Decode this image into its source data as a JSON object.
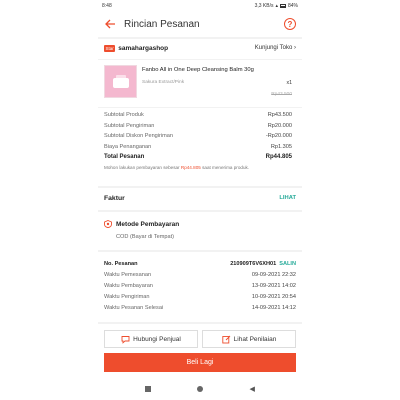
{
  "statusbar": {
    "time": "8:48",
    "speed": "3,3 KB/s",
    "battery": "84%"
  },
  "header": {
    "title": "Rincian Pesanan",
    "help_icon": "?"
  },
  "shop": {
    "badge": "Star",
    "name": "samahargashop",
    "visit_label": "Kunjungi Toko"
  },
  "product": {
    "name": "Fanbo All in One Deep Cleansing Balm 30g",
    "variant": "Sakura Extract/Pink",
    "qty": "x1",
    "price": "Rp43.500"
  },
  "summary": {
    "rows": [
      {
        "label": "Subtotal Produk",
        "value": "Rp43.500"
      },
      {
        "label": "Subtotal Pengiriman",
        "value": "Rp20.000"
      },
      {
        "label": "Subtotal Diskon Pengiriman",
        "value": "-Rp20.000"
      },
      {
        "label": "Biaya Penanganan",
        "value": "Rp1.305"
      }
    ],
    "total_label": "Total Pesanan",
    "total_value": "Rp44.805",
    "note_prefix": "Mohon lakukan pembayaran sebesar",
    "note_amount": "Rp44.805",
    "note_suffix": "saat menerima produk."
  },
  "invoice": {
    "label": "Faktur",
    "link": "LIHAT"
  },
  "payment": {
    "title": "Metode Pembayaran",
    "method": "COD (Bayar di Tempat)"
  },
  "order": {
    "number_label": "No. Pesanan",
    "number_value": "210909T6V6XH01",
    "copy_label": "SALIN",
    "rows": [
      {
        "label": "Waktu Pemesanan",
        "value": "09-09-2021 22:32"
      },
      {
        "label": "Waktu Pembayaran",
        "value": "13-09-2021 14:02"
      },
      {
        "label": "Waktu Pengiriman",
        "value": "10-09-2021 20:54"
      },
      {
        "label": "Waktu Pesanan Selesai",
        "value": "14-09-2021 14:12"
      }
    ]
  },
  "actions": {
    "contact_seller": "Hubungi Penjual",
    "view_rating": "Lihat Penilaian",
    "buy_again": "Beli Lagi"
  },
  "colors": {
    "accent": "#ee4d2d",
    "link": "#26aa99"
  }
}
